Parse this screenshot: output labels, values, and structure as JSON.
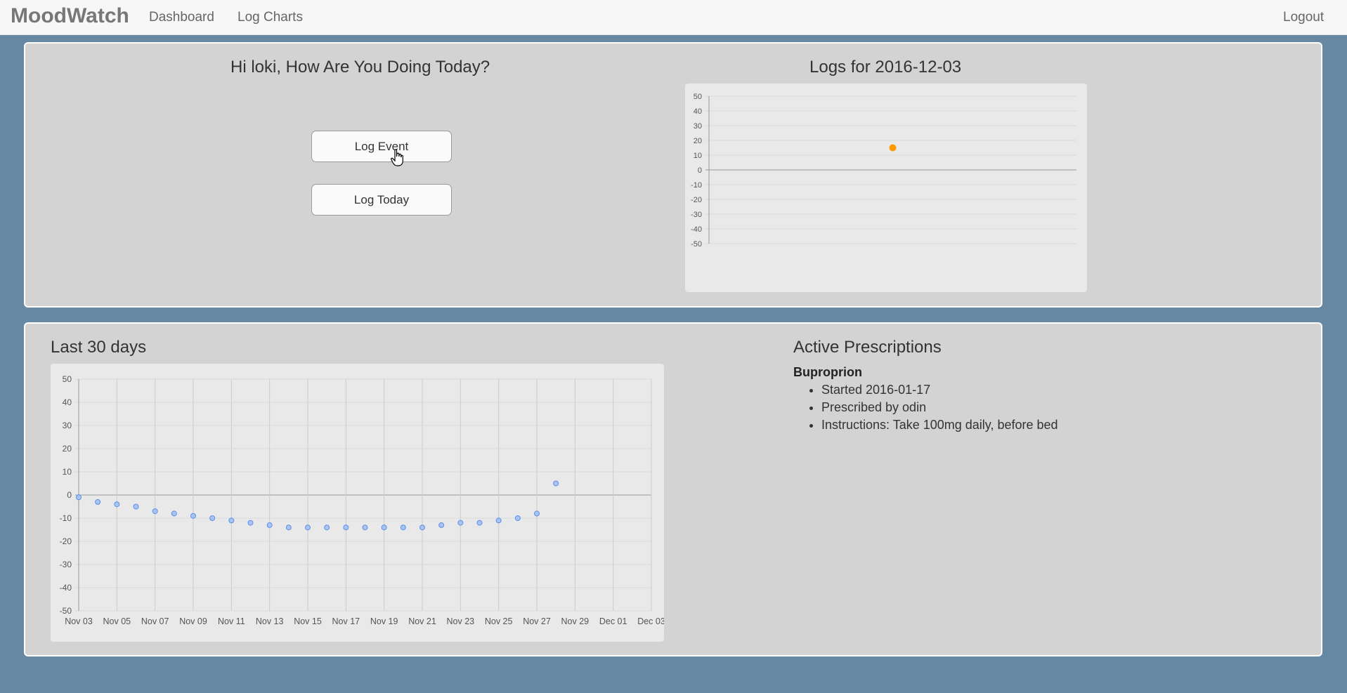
{
  "nav": {
    "brand": "MoodWatch",
    "links": [
      "Dashboard",
      "Log Charts"
    ],
    "logout": "Logout"
  },
  "greeting": "Hi loki, How Are You Doing Today?",
  "buttons": {
    "log_event": "Log Event",
    "log_today": "Log Today"
  },
  "today_chart_title": "Logs for 2016-12-03",
  "history_title": "Last 30 days",
  "prescriptions": {
    "title": "Active Prescriptions",
    "name": "Buproprion",
    "details": [
      "Started 2016-01-17",
      "Prescribed by odin",
      "Instructions: Take 100mg daily, before bed"
    ]
  },
  "colors": {
    "accent_orange": "#ff9900",
    "point_blue": "#5b8fe8",
    "background": "#6788a3",
    "panel": "#d3d3d3"
  },
  "chart_data": [
    {
      "type": "scatter",
      "title": "Logs for 2016-12-03",
      "ylim": [
        -50,
        50
      ],
      "yticks": [
        50,
        40,
        30,
        20,
        10,
        0,
        -10,
        -20,
        -30,
        -40,
        -50
      ],
      "points": [
        {
          "x": 0.5,
          "y": 15
        }
      ],
      "color": "#ff9900",
      "grid": true
    },
    {
      "type": "scatter",
      "title": "Last 30 days",
      "ylim": [
        -50,
        50
      ],
      "yticks": [
        50,
        40,
        30,
        20,
        10,
        0,
        -10,
        -20,
        -30,
        -40,
        -50
      ],
      "xticks": [
        "Nov 03",
        "Nov 05",
        "Nov 07",
        "Nov 09",
        "Nov 11",
        "Nov 13",
        "Nov 15",
        "Nov 17",
        "Nov 19",
        "Nov 21",
        "Nov 23",
        "Nov 25",
        "Nov 27",
        "Nov 29",
        "Dec 01",
        "Dec 03"
      ],
      "x": [
        "Nov 03",
        "Nov 04",
        "Nov 05",
        "Nov 06",
        "Nov 07",
        "Nov 08",
        "Nov 09",
        "Nov 10",
        "Nov 11",
        "Nov 12",
        "Nov 13",
        "Nov 14",
        "Nov 15",
        "Nov 16",
        "Nov 17",
        "Nov 18",
        "Nov 19",
        "Nov 20",
        "Nov 21",
        "Nov 22",
        "Nov 23",
        "Nov 24",
        "Nov 25",
        "Nov 26",
        "Nov 27",
        "Nov 28"
      ],
      "y": [
        -1,
        -3,
        -4,
        -5,
        -7,
        -8,
        -9,
        -10,
        -11,
        -12,
        -13,
        -14,
        -14,
        -14,
        -14,
        -14,
        -14,
        -14,
        -14,
        -13,
        -12,
        -12,
        -11,
        -10,
        -8,
        5
      ],
      "color": "#5b8fe8",
      "grid": true
    }
  ]
}
